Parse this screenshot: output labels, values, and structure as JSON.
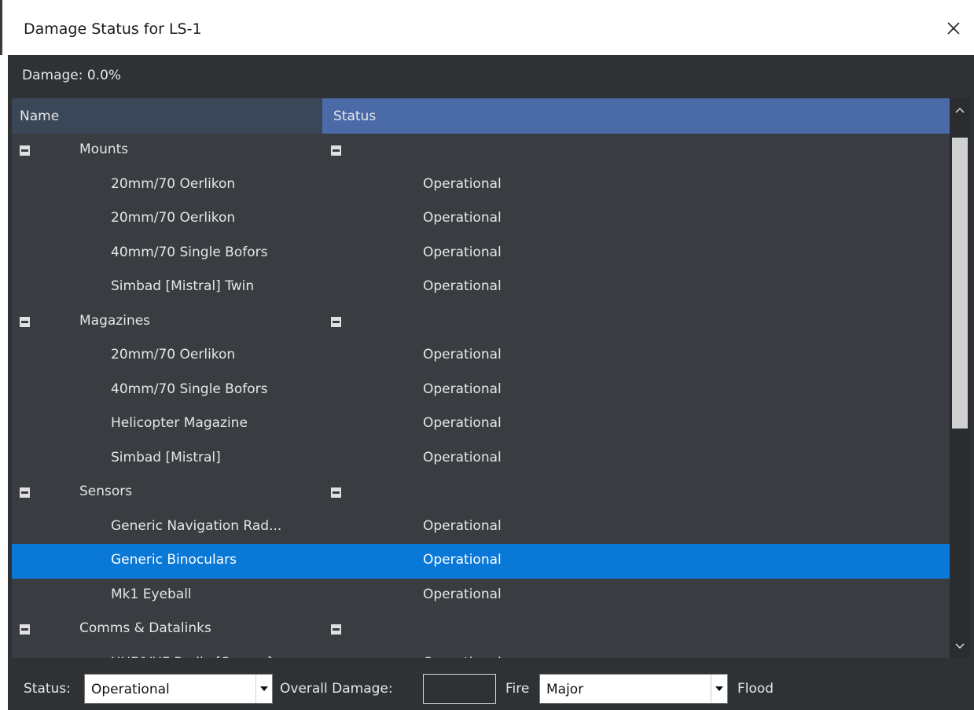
{
  "window": {
    "title": "Damage Status for LS-1",
    "close_icon": "close-icon"
  },
  "damage_label": "Damage: 0.0%",
  "grid": {
    "columns": [
      "Name",
      "Status"
    ],
    "rows": [
      {
        "type": "group",
        "name": "Mounts"
      },
      {
        "type": "item",
        "name": "20mm/70 Oerlikon",
        "status": "Operational"
      },
      {
        "type": "item",
        "name": "20mm/70 Oerlikon",
        "status": "Operational"
      },
      {
        "type": "item",
        "name": "40mm/70 Single Bofors",
        "status": "Operational"
      },
      {
        "type": "item",
        "name": "Simbad [Mistral] Twin",
        "status": "Operational"
      },
      {
        "type": "group",
        "name": "Magazines"
      },
      {
        "type": "item",
        "name": "20mm/70 Oerlikon",
        "status": "Operational"
      },
      {
        "type": "item",
        "name": "40mm/70 Single Bofors",
        "status": "Operational"
      },
      {
        "type": "item",
        "name": "Helicopter Magazine",
        "status": "Operational"
      },
      {
        "type": "item",
        "name": "Simbad [Mistral]",
        "status": "Operational"
      },
      {
        "type": "group",
        "name": "Sensors"
      },
      {
        "type": "item",
        "name": "Generic Navigation Rad...",
        "status": "Operational"
      },
      {
        "type": "item",
        "name": "Generic Binoculars",
        "status": "Operational",
        "selected": true
      },
      {
        "type": "item",
        "name": "Mk1 Eyeball",
        "status": "Operational"
      },
      {
        "type": "group",
        "name": "Comms & Datalinks"
      },
      {
        "type": "item",
        "name": "UHF/VHF Radio [Secure]",
        "status": "Operational",
        "partial": true
      }
    ],
    "selected_color": "#0a78d7"
  },
  "footer": {
    "status_label": "Status:",
    "status_value": "Operational",
    "overall_damage_label": "Overall Damage:",
    "overall_damage_value": "",
    "fire_label": "Fire",
    "fire_value": "Major",
    "flood_label": "Flood"
  }
}
